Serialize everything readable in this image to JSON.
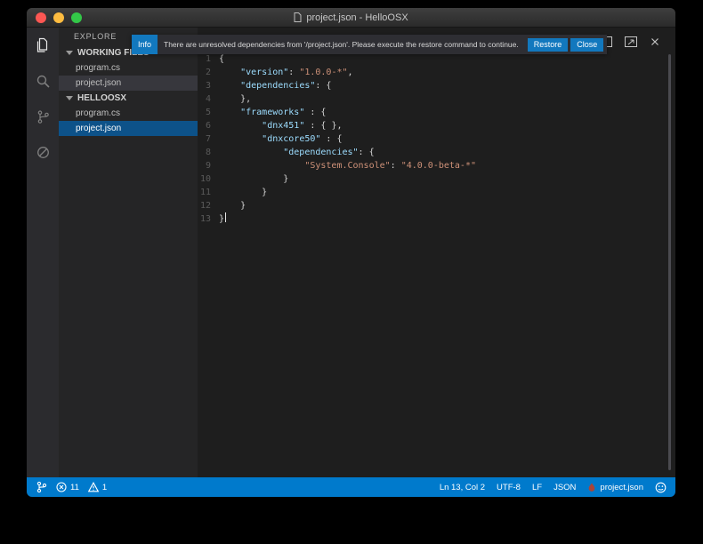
{
  "window": {
    "title": "project.json - HelloOSX"
  },
  "colors": {
    "status_bar": "#007ACC",
    "accent_blue": "#1278BE",
    "selection_blue": "#0D5289",
    "traffic_red": "#FC5753",
    "traffic_yellow": "#FDBC40",
    "traffic_green": "#33C748",
    "json_key": "#9CDCFE",
    "json_string": "#CE9178",
    "editor_bg": "#1E1E1E",
    "sidebar_bg": "#252526"
  },
  "notification": {
    "badge": "Info",
    "message": "There are unresolved dependencies from '/project.json'. Please execute the restore command to continue.",
    "restore_label": "Restore",
    "close_label": "Close"
  },
  "icons": {
    "titlebar": [
      "close-window-button",
      "minimize-window-button",
      "zoom-window-button",
      "document-icon"
    ],
    "activity_bar": [
      "explorer-icon",
      "search-icon",
      "git-icon",
      "debug-icon"
    ],
    "editor_actions": [
      "split-editor-icon",
      "open-preview-icon",
      "close-editor-icon"
    ],
    "status_left": [
      "git-branch-icon",
      "errors-icon",
      "warnings-icon"
    ],
    "status_right": [
      "flame-icon",
      "feedback-smiley-icon"
    ]
  },
  "sidebar": {
    "title": "EXPLORE",
    "sections": [
      {
        "label": "WORKING FILES",
        "items": [
          {
            "name": "program.cs",
            "state": ""
          },
          {
            "name": "project.json",
            "state": "focused"
          }
        ]
      },
      {
        "label": "HELLOOSX",
        "items": [
          {
            "name": "program.cs",
            "state": ""
          },
          {
            "name": "project.json",
            "state": "selected"
          }
        ]
      }
    ]
  },
  "editor": {
    "language": "json",
    "lines": [
      {
        "n": "1",
        "tokens": [
          [
            "p",
            "{"
          ]
        ]
      },
      {
        "n": "2",
        "tokens": [
          [
            "p",
            "    "
          ],
          [
            "k",
            "\"version\""
          ],
          [
            "p",
            ": "
          ],
          [
            "s",
            "\"1.0.0-*\""
          ],
          [
            "p",
            ","
          ]
        ]
      },
      {
        "n": "3",
        "tokens": [
          [
            "p",
            "    "
          ],
          [
            "k",
            "\"dependencies\""
          ],
          [
            "p",
            ": {"
          ]
        ]
      },
      {
        "n": "4",
        "tokens": [
          [
            "p",
            "    },"
          ]
        ]
      },
      {
        "n": "5",
        "tokens": [
          [
            "p",
            "    "
          ],
          [
            "k",
            "\"frameworks\""
          ],
          [
            "p",
            " : {"
          ]
        ]
      },
      {
        "n": "6",
        "tokens": [
          [
            "p",
            "        "
          ],
          [
            "k",
            "\"dnx451\""
          ],
          [
            "p",
            " : { },"
          ]
        ]
      },
      {
        "n": "7",
        "tokens": [
          [
            "p",
            "        "
          ],
          [
            "k",
            "\"dnxcore50\""
          ],
          [
            "p",
            " : {"
          ]
        ]
      },
      {
        "n": "8",
        "tokens": [
          [
            "p",
            "            "
          ],
          [
            "k",
            "\"dependencies\""
          ],
          [
            "p",
            ": {"
          ]
        ]
      },
      {
        "n": "9",
        "tokens": [
          [
            "p",
            "                "
          ],
          [
            "s",
            "\"System.Console\""
          ],
          [
            "p",
            ": "
          ],
          [
            "s",
            "\"4.0.0-beta-*\""
          ]
        ]
      },
      {
        "n": "10",
        "tokens": [
          [
            "p",
            "            }"
          ]
        ]
      },
      {
        "n": "11",
        "tokens": [
          [
            "p",
            "        }"
          ]
        ]
      },
      {
        "n": "12",
        "tokens": [
          [
            "p",
            "    }"
          ]
        ]
      },
      {
        "n": "13",
        "tokens": [
          [
            "p",
            "}"
          ]
        ],
        "cursor": true
      }
    ]
  },
  "status_bar": {
    "errors": "11",
    "warnings": "1",
    "cursor": "Ln 13, Col 2",
    "encoding": "UTF-8",
    "eol": "LF",
    "language": "JSON",
    "project": "project.json"
  }
}
